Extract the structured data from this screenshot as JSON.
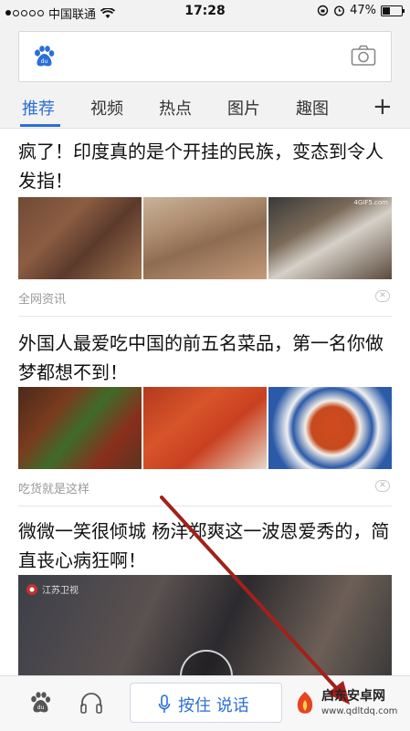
{
  "status_bar": {
    "carrier": "中国联通",
    "time": "17:28",
    "battery": "47%",
    "battery_level": 0.47
  },
  "search": {
    "placeholder": ""
  },
  "tabs": [
    {
      "label": "推荐",
      "active": true
    },
    {
      "label": "视频"
    },
    {
      "label": "热点"
    },
    {
      "label": "图片"
    },
    {
      "label": "趣图"
    }
  ],
  "add_tab_label": "+",
  "feed": [
    {
      "title": "疯了！印度真的是个开挂的民族，变态到令人发指！",
      "source": "全网资讯",
      "thumbs": [
        "wrestlers-mud-photo",
        "laborers-photo",
        "chef-cooking-photo"
      ],
      "thumb_caption": "4GIF5.com"
    },
    {
      "title": "外国人最爱吃中国的前五名菜品，第一名你做梦都想不到！",
      "source": "吃货就是这样",
      "thumbs": [
        "stir-fry-peppers-photo",
        "spicy-chicken-photo",
        "mapo-tofu-photo"
      ]
    },
    {
      "title": "微微一笑很倾城 杨洋郑爽这一波恩爱秀的，简直丧心病狂啊！",
      "video_channel": "江苏卫视"
    }
  ],
  "bottom_bar": {
    "voice_label": "按住 说话"
  },
  "watermark": {
    "title": "启东安卓网",
    "url": "www.qdltdq.com"
  },
  "colors": {
    "accent": "#2b6fd6",
    "arrow": "#a2211a",
    "watermark": "#e8441f"
  }
}
